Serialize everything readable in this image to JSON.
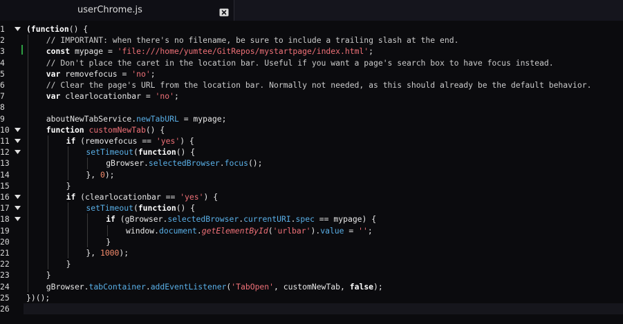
{
  "tab": {
    "title": "userChrome.js",
    "close_icon": "close-icon"
  },
  "colors": {
    "keyword": "#ffffff",
    "string": "#f07178",
    "comment": "#cccccc",
    "property": "#5ab0e8",
    "number": "#f78c6c",
    "git_added": "#2ea043"
  },
  "line_numbers": [
    "1",
    "2",
    "3",
    "4",
    "5",
    "6",
    "7",
    "8",
    "9",
    "10",
    "11",
    "12",
    "13",
    "14",
    "15",
    "16",
    "17",
    "18",
    "19",
    "20",
    "21",
    "22",
    "23",
    "24",
    "25",
    "26"
  ],
  "fold_lines": [
    1,
    10,
    11,
    12,
    16,
    17,
    18
  ],
  "code": [
    {
      "indent": 0,
      "tokens": [
        [
          "kw",
          "(function"
        ],
        [
          "id",
          "() {"
        ]
      ]
    },
    {
      "indent": 1,
      "tokens": [
        [
          "cmt",
          "// IMPORTANT: when there's no filename, be sure to include a trailing slash at the end."
        ]
      ]
    },
    {
      "indent": 1,
      "tokens": [
        [
          "kw",
          "const "
        ],
        [
          "id",
          "mypage = "
        ],
        [
          "str",
          "'file:///home/yumtee/GitRepos/mystartpage/index.html'"
        ],
        [
          "id",
          ";"
        ]
      ]
    },
    {
      "indent": 1,
      "tokens": [
        [
          "cmt",
          "// Don't place the caret in the location bar. Useful if you want a page's search box to have focus instead."
        ]
      ]
    },
    {
      "indent": 1,
      "tokens": [
        [
          "kw",
          "var "
        ],
        [
          "id",
          "removefocus = "
        ],
        [
          "str",
          "'no'"
        ],
        [
          "id",
          ";"
        ]
      ]
    },
    {
      "indent": 1,
      "tokens": [
        [
          "cmt",
          "// Clear the page's URL from the location bar. Normally not needed, as this should already be the default behavior."
        ]
      ]
    },
    {
      "indent": 1,
      "tokens": [
        [
          "kw",
          "var "
        ],
        [
          "id",
          "clearlocationbar = "
        ],
        [
          "str",
          "'no'"
        ],
        [
          "id",
          ";"
        ]
      ]
    },
    {
      "indent": 0,
      "tokens": []
    },
    {
      "indent": 1,
      "tokens": [
        [
          "id",
          "aboutNewTabService."
        ],
        [
          "prop",
          "newTabURL"
        ],
        [
          "id",
          " = mypage;"
        ]
      ]
    },
    {
      "indent": 1,
      "tokens": [
        [
          "kw",
          "function "
        ],
        [
          "fn",
          "customNewTab"
        ],
        [
          "id",
          "() {"
        ]
      ]
    },
    {
      "indent": 2,
      "tokens": [
        [
          "kw",
          "if "
        ],
        [
          "id",
          "(removefocus == "
        ],
        [
          "str",
          "'yes'"
        ],
        [
          "id",
          ") {"
        ]
      ]
    },
    {
      "indent": 3,
      "tokens": [
        [
          "prop",
          "setTimeout"
        ],
        [
          "id",
          "("
        ],
        [
          "kw",
          "function"
        ],
        [
          "id",
          "() {"
        ]
      ]
    },
    {
      "indent": 4,
      "tokens": [
        [
          "id",
          "gBrowser."
        ],
        [
          "prop",
          "selectedBrowser"
        ],
        [
          "id",
          "."
        ],
        [
          "prop",
          "focus"
        ],
        [
          "id",
          "();"
        ]
      ]
    },
    {
      "indent": 3,
      "tokens": [
        [
          "id",
          "}, "
        ],
        [
          "num",
          "0"
        ],
        [
          "id",
          ");"
        ]
      ]
    },
    {
      "indent": 2,
      "tokens": [
        [
          "id",
          "}"
        ]
      ]
    },
    {
      "indent": 2,
      "tokens": [
        [
          "kw",
          "if "
        ],
        [
          "id",
          "(clearlocationbar == "
        ],
        [
          "str",
          "'yes'"
        ],
        [
          "id",
          ") {"
        ]
      ]
    },
    {
      "indent": 3,
      "tokens": [
        [
          "prop",
          "setTimeout"
        ],
        [
          "id",
          "("
        ],
        [
          "kw",
          "function"
        ],
        [
          "id",
          "() {"
        ]
      ]
    },
    {
      "indent": 4,
      "tokens": [
        [
          "kw",
          "if "
        ],
        [
          "id",
          "(gBrowser."
        ],
        [
          "prop",
          "selectedBrowser"
        ],
        [
          "id",
          "."
        ],
        [
          "prop",
          "currentURI"
        ],
        [
          "id",
          "."
        ],
        [
          "prop",
          "spec"
        ],
        [
          "id",
          " == mypage) {"
        ]
      ]
    },
    {
      "indent": 5,
      "tokens": [
        [
          "id",
          "window."
        ],
        [
          "prop",
          "document"
        ],
        [
          "id",
          "."
        ],
        [
          "fn ital",
          "getElementById"
        ],
        [
          "id",
          "("
        ],
        [
          "str",
          "'urlbar'"
        ],
        [
          "id",
          ")."
        ],
        [
          "prop",
          "value"
        ],
        [
          "id",
          " = "
        ],
        [
          "str",
          "''"
        ],
        [
          "id",
          ";"
        ]
      ]
    },
    {
      "indent": 4,
      "tokens": [
        [
          "id",
          "}"
        ]
      ]
    },
    {
      "indent": 3,
      "tokens": [
        [
          "id",
          "}, "
        ],
        [
          "num",
          "1000"
        ],
        [
          "id",
          ");"
        ]
      ]
    },
    {
      "indent": 2,
      "tokens": [
        [
          "id",
          "}"
        ]
      ]
    },
    {
      "indent": 1,
      "tokens": [
        [
          "id",
          "}"
        ]
      ]
    },
    {
      "indent": 1,
      "tokens": [
        [
          "id",
          "gBrowser."
        ],
        [
          "prop",
          "tabContainer"
        ],
        [
          "id",
          "."
        ],
        [
          "prop",
          "addEventListener"
        ],
        [
          "id",
          "("
        ],
        [
          "str",
          "'TabOpen'"
        ],
        [
          "id",
          ", customNewTab, "
        ],
        [
          "kw",
          "false"
        ],
        [
          "id",
          ");"
        ]
      ]
    },
    {
      "indent": 0,
      "tokens": [
        [
          "id",
          "})();"
        ]
      ]
    },
    {
      "indent": 0,
      "tokens": []
    }
  ]
}
